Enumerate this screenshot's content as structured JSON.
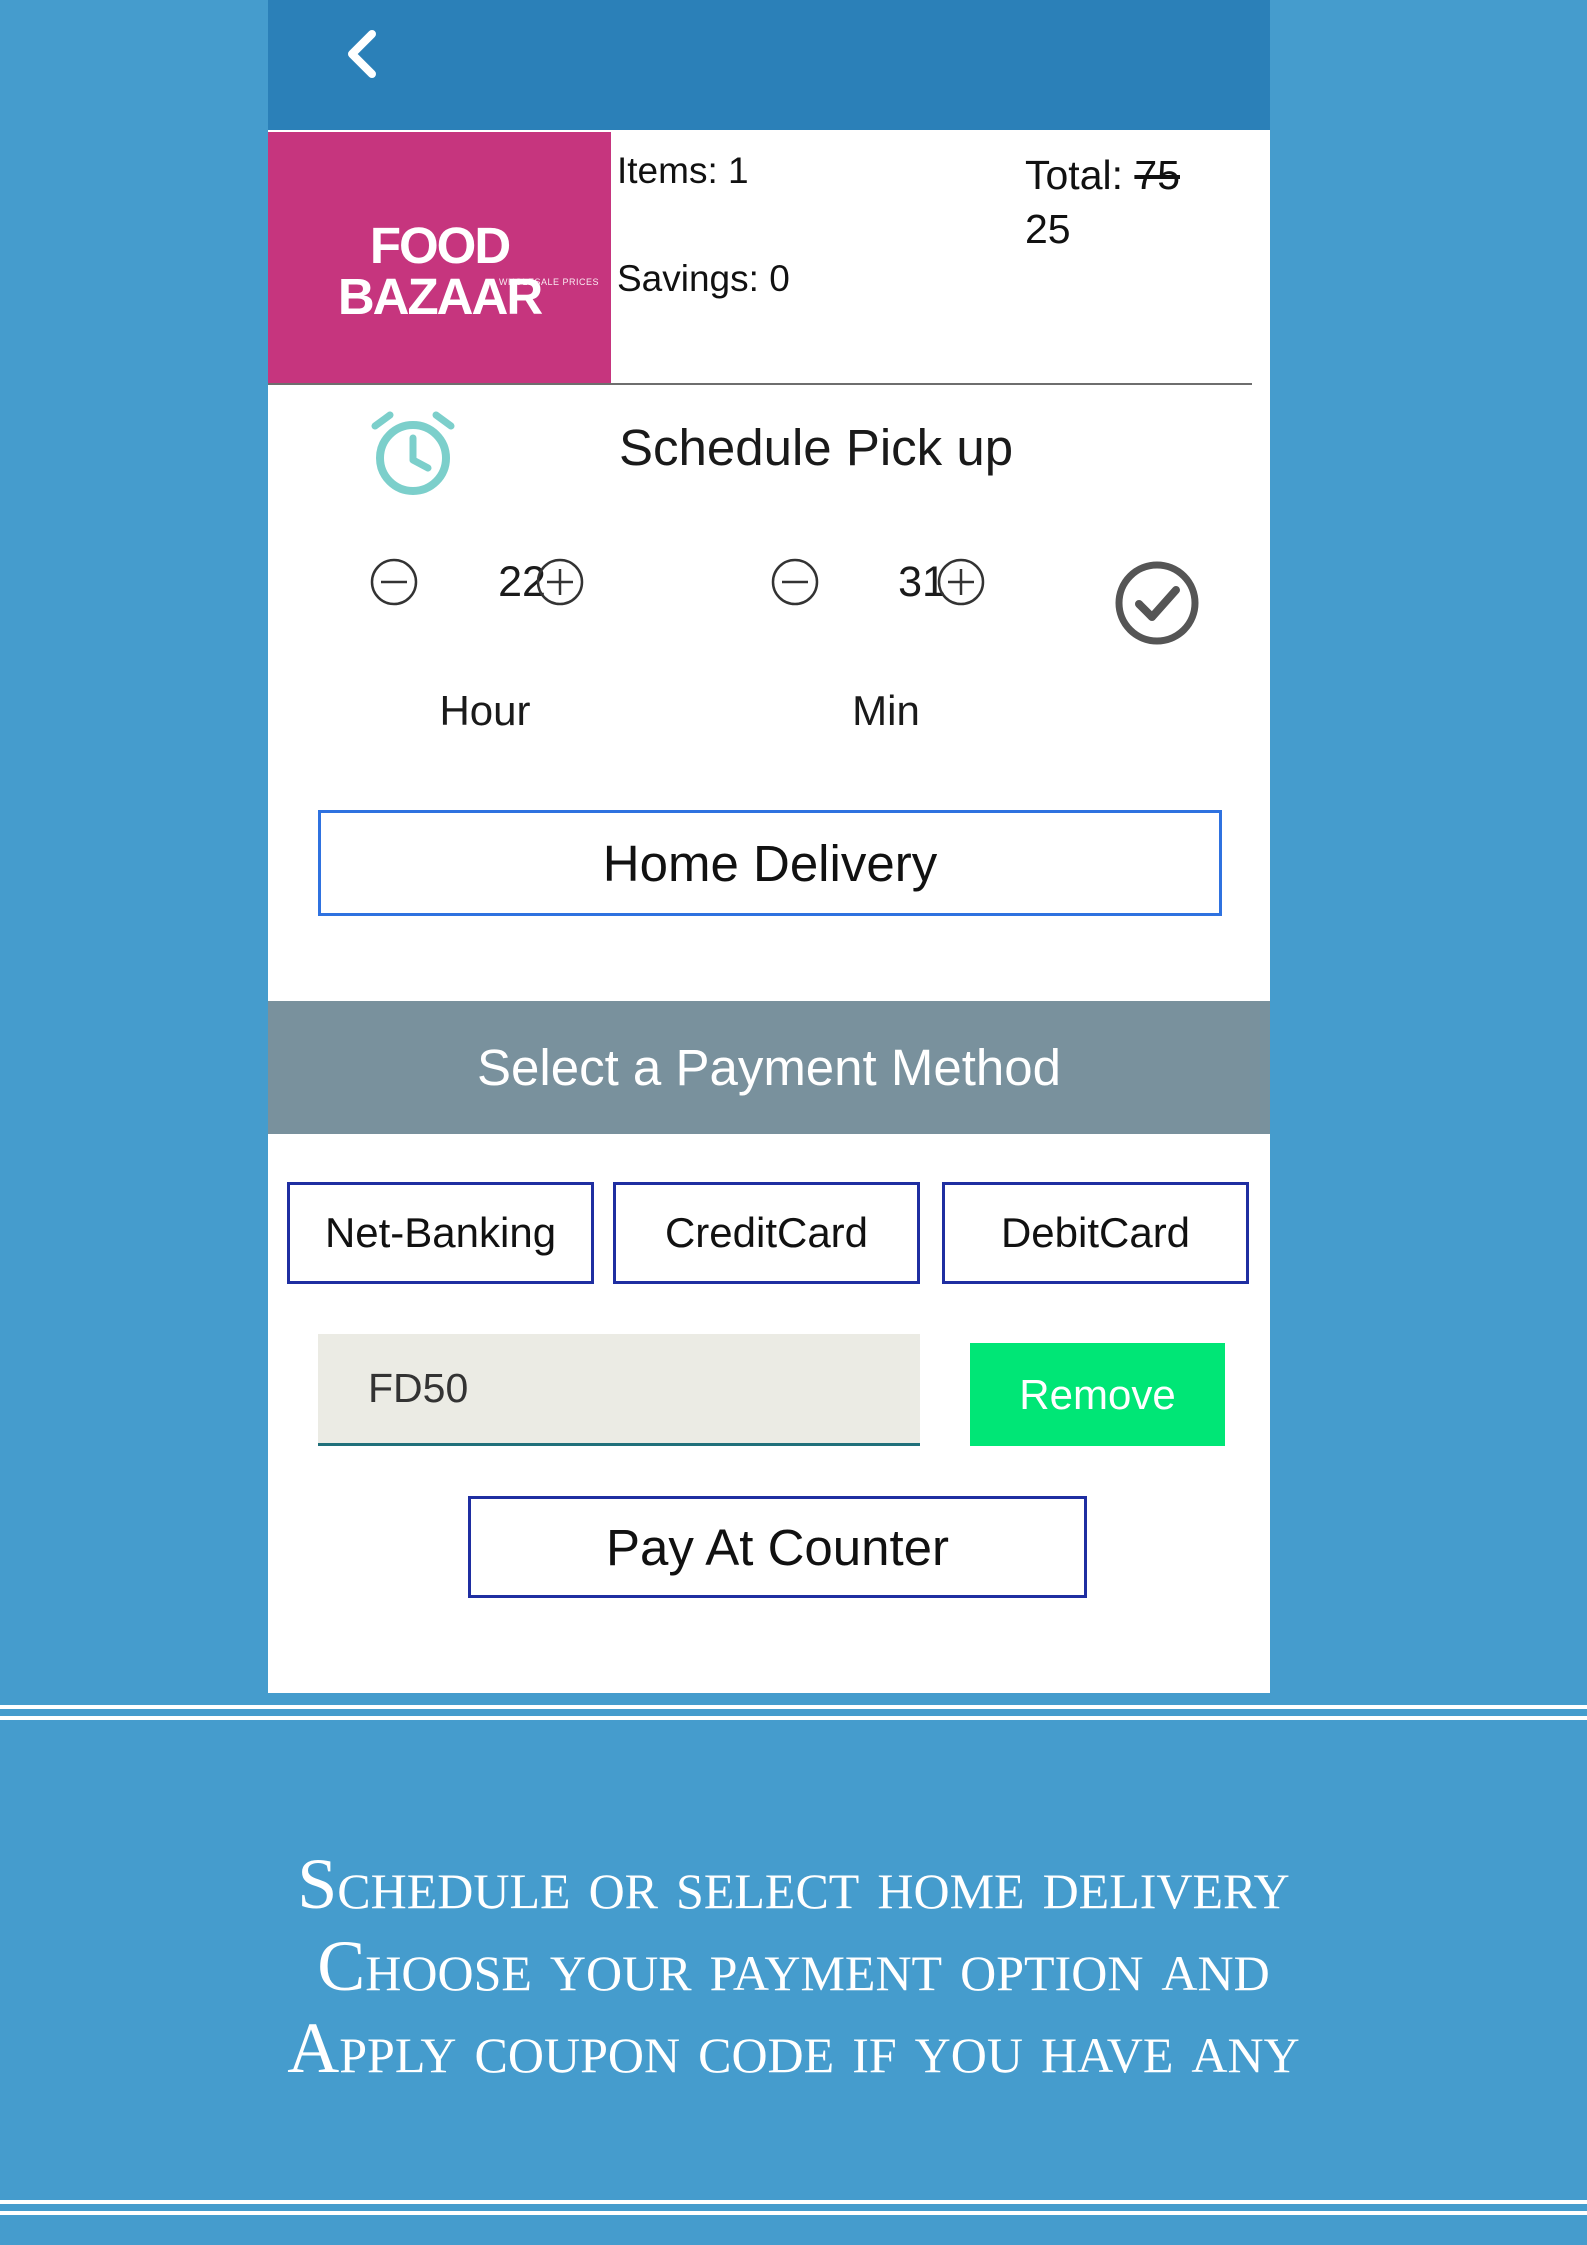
{
  "store": {
    "logo_text": "FOOD BAZAAR",
    "logo_subtext": "WHOLESALE PRICES",
    "items_label": "Items: 1",
    "savings_label": "Savings: 0",
    "total_label": "Total: ",
    "total_original": "75",
    "total_final": "25"
  },
  "schedule": {
    "title": "Schedule Pick up",
    "hour": {
      "value": "22",
      "label": "Hour"
    },
    "minute": {
      "value": "31",
      "label": "Min"
    }
  },
  "delivery": {
    "home_delivery_label": "Home Delivery"
  },
  "payment": {
    "header": "Select a Payment Method",
    "options": [
      "Net-Banking",
      "CreditCard",
      "DebitCard"
    ],
    "coupon_code": "FD50",
    "remove_label": "Remove",
    "pay_at_counter_label": "Pay At Counter"
  },
  "caption": {
    "lines": [
      "Schedule or select home delivery",
      "Choose your payment option and",
      "Apply coupon code if you have any"
    ]
  },
  "colors": {
    "background": "#459ccd",
    "appbar": "#2b80b8",
    "logo": "#c6357e",
    "payment_header": "#79919d",
    "remove_button": "#00e676",
    "alarm_icon": "#7ccfcb"
  }
}
